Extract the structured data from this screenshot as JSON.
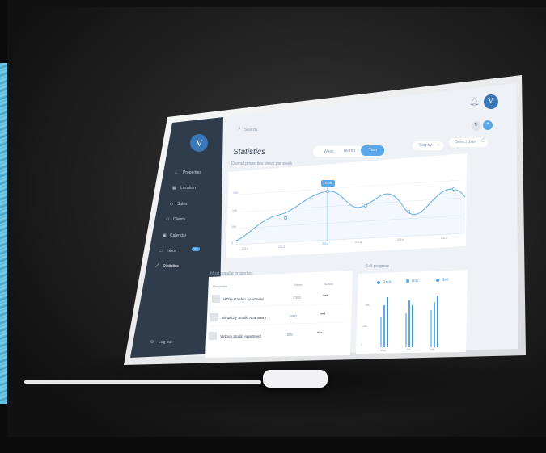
{
  "search": {
    "placeholder": "Search"
  },
  "sidebar": {
    "logo_letter": "V",
    "items": [
      {
        "label": "Properties"
      },
      {
        "label": "Location"
      },
      {
        "label": "Sales"
      },
      {
        "label": "Clients"
      },
      {
        "label": "Calendar"
      },
      {
        "label": "Inbox",
        "badge": "23"
      },
      {
        "label": "Statistics"
      }
    ],
    "logout": "Log out"
  },
  "header": {
    "avatar_letter": "V"
  },
  "page": {
    "title": "Statistics",
    "subtitle": "Overall properties views per week",
    "range_tabs": [
      "Week",
      "Month",
      "Year"
    ],
    "active_tab": "Year",
    "sort_label": "Sort by",
    "date_label": "Select date"
  },
  "line_chart": {
    "tooltip": "17000",
    "x_ticks": [
      "2012",
      "2013",
      "2014",
      "2015",
      "2016",
      "2017"
    ],
    "y_ticks": [
      "20K",
      "15K",
      "10K",
      "5K",
      "0"
    ]
  },
  "popular": {
    "title": "Most popular properties",
    "columns": [
      "Properties",
      "Views",
      "Action"
    ],
    "rows": [
      {
        "name": "White Garden Apartment",
        "views": "2300",
        "action": "•••"
      },
      {
        "name": "Simplicity Studio Apartment",
        "views": "1900",
        "action": "•••"
      },
      {
        "name": "Victoria Studio Apartment",
        "views": "1500",
        "action": "•••"
      }
    ]
  },
  "sell_progress": {
    "title": "Sell progress",
    "legend": [
      "Rent",
      "Buy",
      "Sell"
    ],
    "y_ticks": [
      "15K",
      "10K",
      "5K",
      "0"
    ],
    "x_ticks": [
      "May",
      "Jun",
      "July"
    ]
  },
  "colors": {
    "accent": "#5aa7ea",
    "sidebar": "#2f3c4b",
    "screen_bg": "#eef1f5"
  }
}
